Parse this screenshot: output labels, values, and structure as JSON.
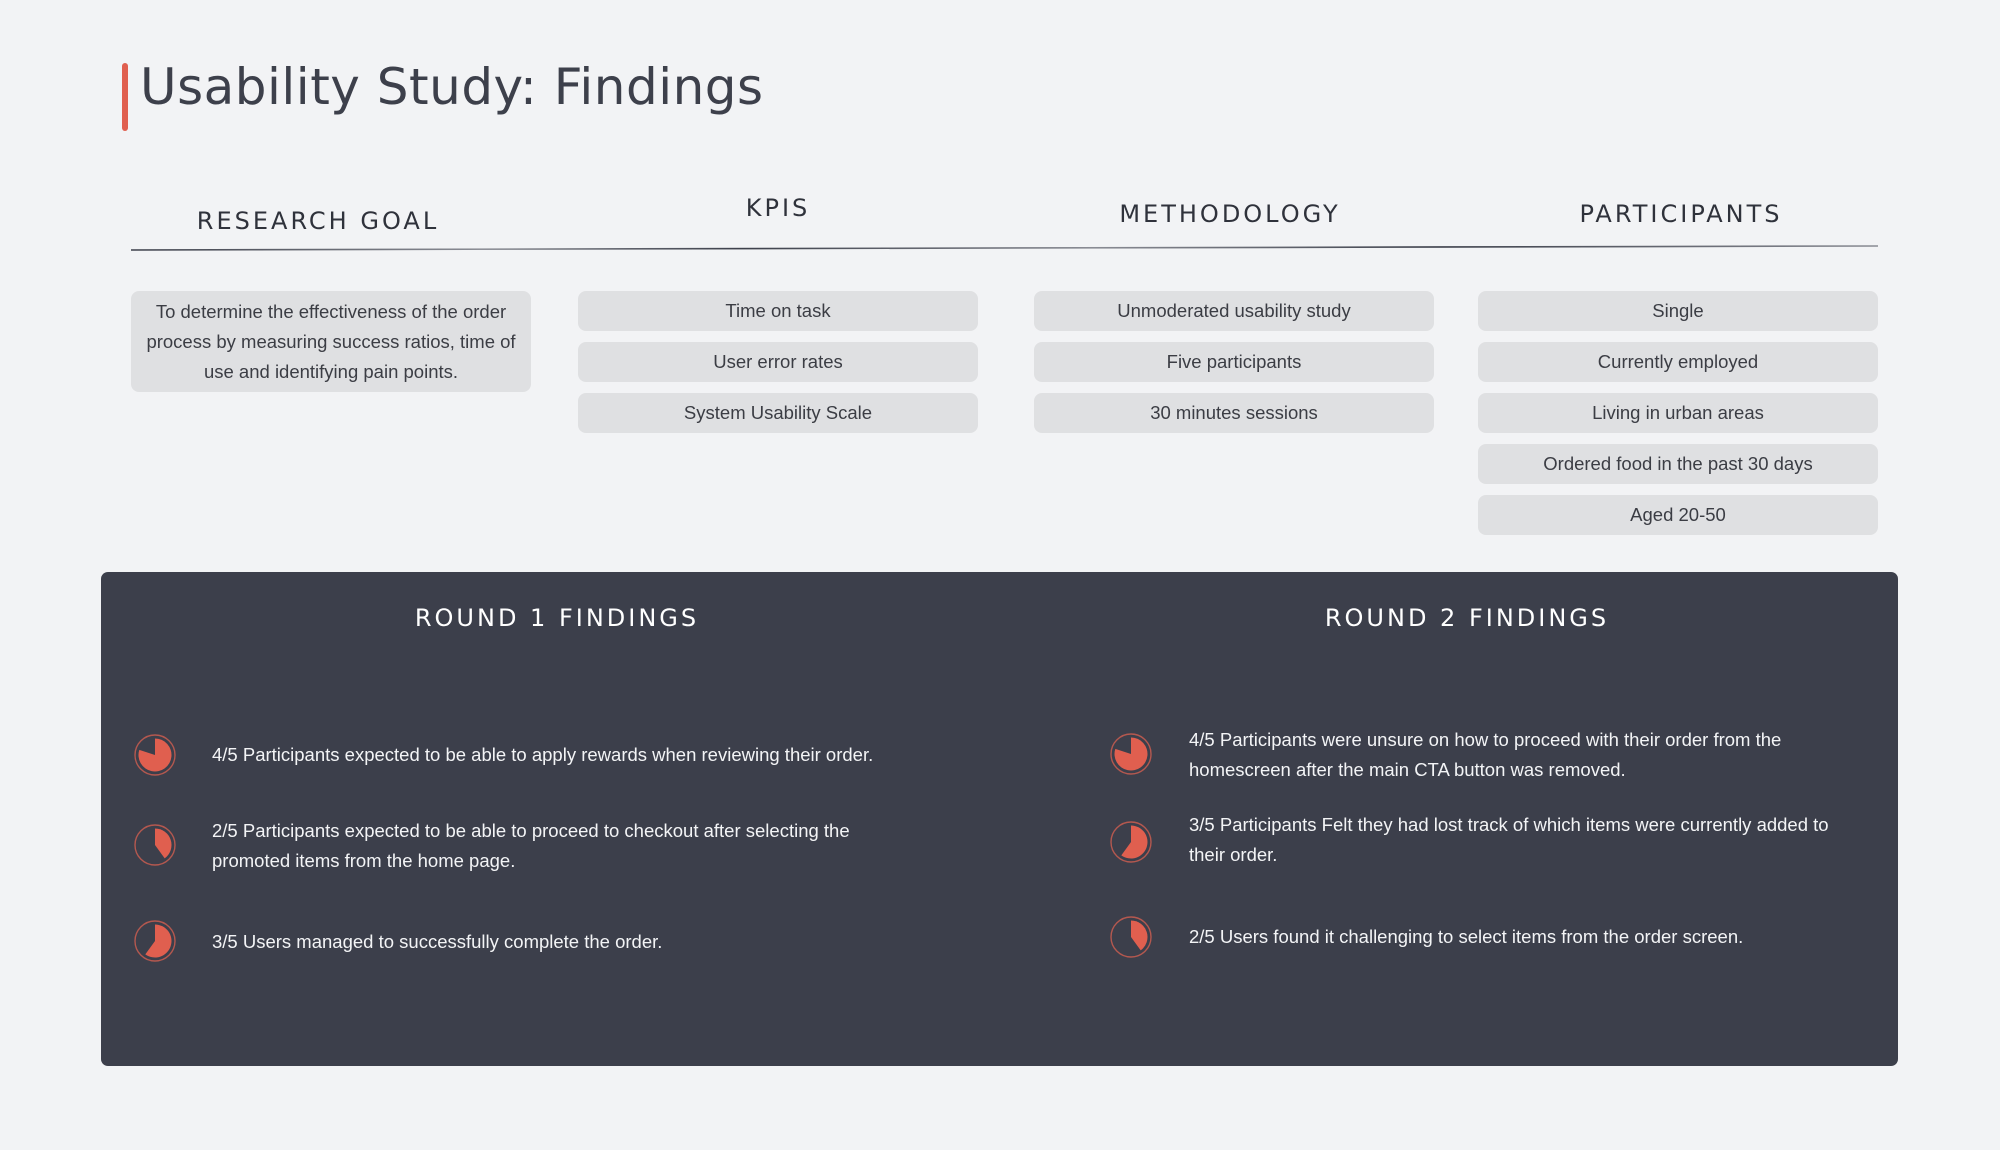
{
  "page": {
    "title": "Usability Study: Findings",
    "accent_color": "#e05f4f",
    "panel_color": "#3c3f4b",
    "background_color": "#f2f3f5"
  },
  "sections": {
    "research_goal": {
      "header": "RESEARCH GOAL",
      "text": "To determine the effectiveness of the order process by measuring success ratios, time of use and identifying pain points."
    },
    "kpis": {
      "header": "KPIS",
      "items": [
        "Time on task",
        "User error rates",
        "System Usability Scale"
      ]
    },
    "methodology": {
      "header": "METHODOLOGY",
      "items": [
        "Unmoderated usability study",
        "Five participants",
        "30 minutes sessions"
      ]
    },
    "participants": {
      "header": "PARTICIPANTS",
      "items": [
        "Single",
        "Currently employed",
        "Living in urban areas",
        "Ordered food in the past 30 days",
        "Aged 20-50"
      ]
    }
  },
  "findings": {
    "round1": {
      "header": "ROUND 1 FINDINGS",
      "items": [
        {
          "icon": "pie-chart-icon",
          "ratio": 0.8,
          "text": "4/5 Participants expected to be able to apply rewards when reviewing their order."
        },
        {
          "icon": "pie-chart-icon",
          "ratio": 0.4,
          "text": "2/5 Participants expected to be able to proceed to checkout after selecting the promoted items from the home page."
        },
        {
          "icon": "pie-chart-icon",
          "ratio": 0.6,
          "text": "3/5 Users managed to successfully complete the order."
        }
      ]
    },
    "round2": {
      "header": "ROUND 2 FINDINGS",
      "items": [
        {
          "icon": "pie-chart-icon",
          "ratio": 0.8,
          "text": "4/5 Participants were unsure on how to proceed with their order from the homescreen after the main CTA button was removed."
        },
        {
          "icon": "pie-chart-icon",
          "ratio": 0.6,
          "text": "3/5 Participants Felt they had lost track of which items were currently added to their order."
        },
        {
          "icon": "pie-chart-icon",
          "ratio": 0.4,
          "text": "2/5 Users found it challenging to select items from the order screen."
        }
      ]
    }
  }
}
